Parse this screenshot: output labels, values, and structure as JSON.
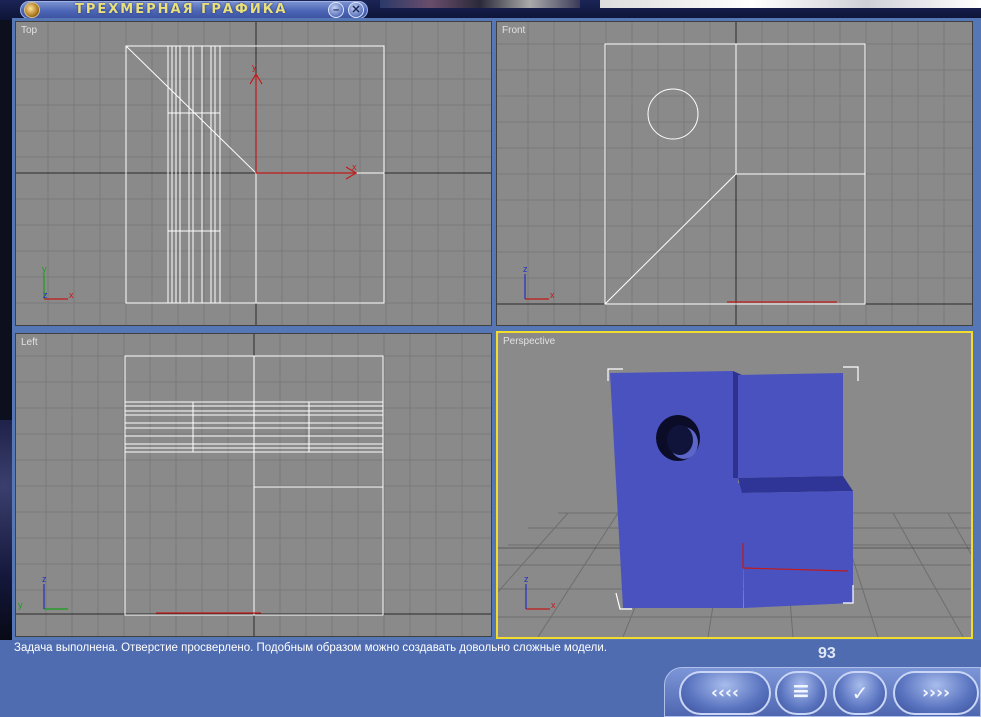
{
  "window": {
    "title": "ТРЕХМЕРНАЯ ГРАФИКА",
    "minimize_glyph": "–",
    "close_glyph": "✕"
  },
  "viewports": {
    "top": {
      "label": "Top",
      "axis_x": "x",
      "axis_y": "y",
      "axis_z": "z"
    },
    "front": {
      "label": "Front",
      "axis_x": "x",
      "axis_z": "z"
    },
    "left": {
      "label": "Left",
      "axis_y": "y",
      "axis_z": "z"
    },
    "perspective": {
      "label": "Perspective",
      "axis_x": "x",
      "axis_z": "z"
    }
  },
  "status": {
    "message": "Задача выполнена. Отверстие просверлено. Подобным образом можно создавать довольно сложные модели.",
    "page_number": "93"
  },
  "navigation": {
    "back_glyph": "‹‹‹‹",
    "menu_glyph": "≡",
    "check_glyph": "✓",
    "forward_glyph": "››››"
  },
  "colors": {
    "viewport_bg": "#8a8a8a",
    "frame": "#5577b6",
    "active_border": "#f2dd2c",
    "object_blue": "#4a52c0",
    "title_text": "#e9e07a"
  }
}
